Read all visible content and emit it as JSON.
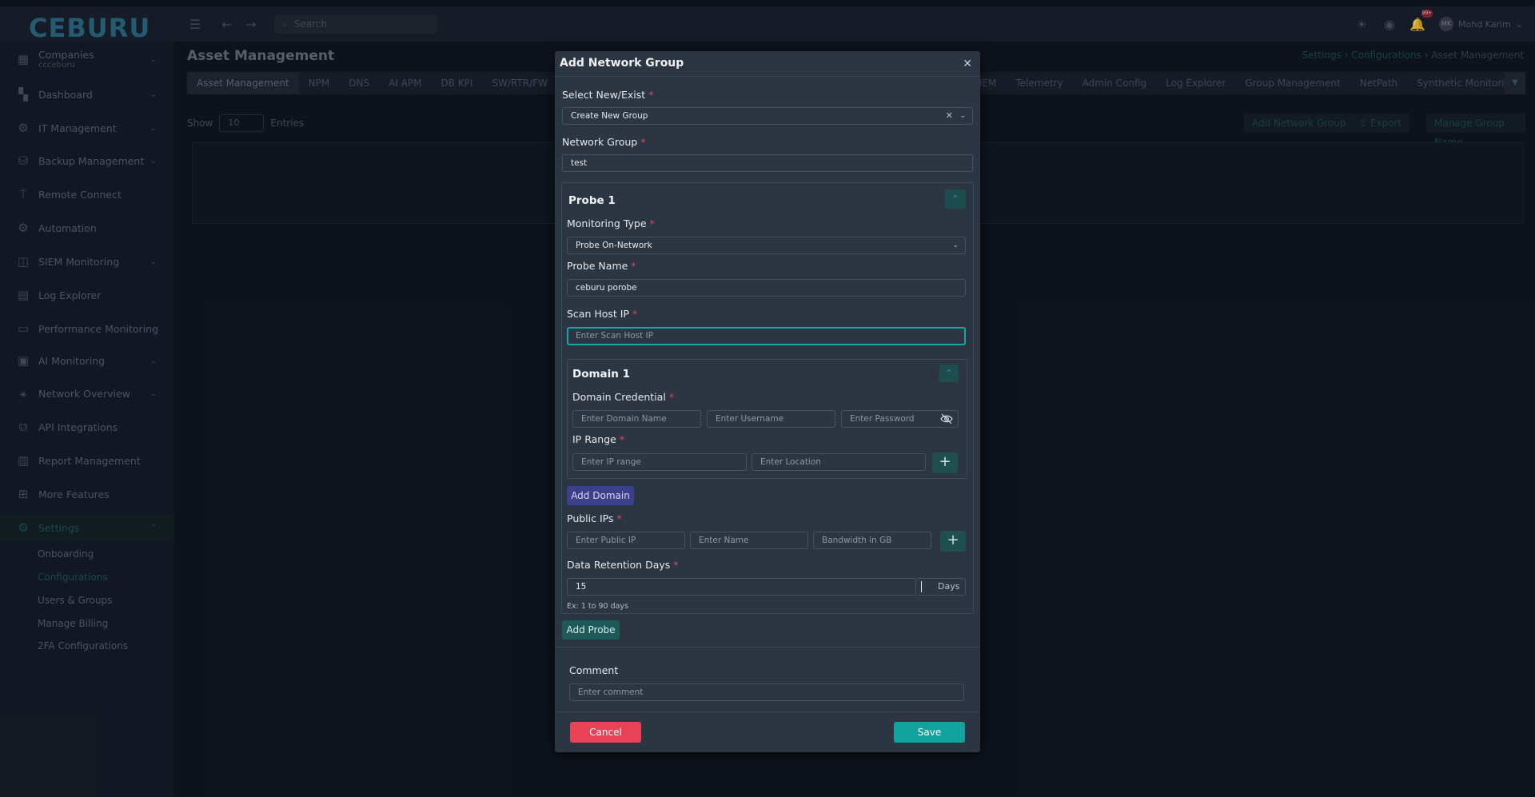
{
  "app": {
    "logo": "CEBURU",
    "search_placeholder": "Search",
    "user_name": "Mohd Karim",
    "user_initials": "MK",
    "notification_count": "99+"
  },
  "sidebar": {
    "company_label": "Companies",
    "company_name": "ccceburu",
    "items": [
      {
        "label": "Dashboard",
        "icon": "dashboard-icon"
      },
      {
        "label": "IT Management",
        "icon": "it-management-icon"
      },
      {
        "label": "Backup Management",
        "icon": "database-icon"
      },
      {
        "label": "Remote Connect",
        "icon": "remote-icon"
      },
      {
        "label": "Automation",
        "icon": "gear-icon"
      },
      {
        "label": "SIEM Monitoring",
        "icon": "siem-icon"
      },
      {
        "label": "Log Explorer",
        "icon": "file-icon"
      },
      {
        "label": "Performance Monitoring",
        "icon": "monitor-icon"
      },
      {
        "label": "AI Monitoring",
        "icon": "ai-icon"
      },
      {
        "label": "Network Overview",
        "icon": "network-icon"
      },
      {
        "label": "API Integrations",
        "icon": "api-icon"
      },
      {
        "label": "Report Management",
        "icon": "report-icon"
      },
      {
        "label": "More Features",
        "icon": "grid-icon"
      },
      {
        "label": "Settings",
        "icon": "settings-icon"
      }
    ],
    "settings_sub": [
      "Onboarding",
      "Configurations",
      "Users & Groups",
      "Manage Billing",
      "2FA Configurations"
    ]
  },
  "page": {
    "title": "Asset Management",
    "breadcrumb": [
      "Settings",
      "Configurations",
      "Asset Management"
    ],
    "tabs": [
      "Asset Management",
      "NPM",
      "DNS",
      "AI APM",
      "DB KPI",
      "SW/RTR/FW",
      "IEM",
      "Telemetry",
      "Admin Config",
      "Log Explorer",
      "Group Management",
      "NetPath",
      "Synthetic Monitoring"
    ],
    "show_label": "Show",
    "entries_value": "10",
    "entries_label": "Entries",
    "add_network_group": "Add Network Group",
    "export": "Export",
    "manage_group_name": "Manage Group Name"
  },
  "modal": {
    "title": "Add Network Group",
    "select_label": "Select New/Exist",
    "select_value": "Create New Group",
    "network_group_label": "Network Group",
    "network_group_value": "test",
    "probe": {
      "title": "Probe 1",
      "monitoring_type_label": "Monitoring Type",
      "monitoring_type_value": "Probe On-Network",
      "probe_name_label": "Probe Name",
      "probe_name_value": "ceburu porobe",
      "scan_host_label": "Scan Host IP",
      "scan_host_placeholder": "Enter Scan Host IP",
      "domain": {
        "title": "Domain 1",
        "credential_label": "Domain Credential",
        "domain_name_placeholder": "Enter Domain Name",
        "username_placeholder": "Enter Username",
        "password_placeholder": "Enter Password",
        "ip_range_label": "IP Range",
        "ip_range_placeholder": "Enter IP range",
        "location_placeholder": "Enter Location"
      },
      "add_domain": "Add Domain",
      "public_ips_label": "Public IPs",
      "public_ip_placeholder": "Enter Public IP",
      "name_placeholder": "Enter Name",
      "bandwidth_placeholder": "Bandwidth in GB",
      "retention_label": "Data Retention Days",
      "retention_value": "15",
      "retention_unit": "Days",
      "retention_hint": "Ex: 1 to 90 days"
    },
    "add_probe": "Add Probe",
    "comment_label": "Comment",
    "comment_placeholder": "Enter comment",
    "cancel": "Cancel",
    "save": "Save"
  },
  "colors": {
    "accent": "#14a39c",
    "danger": "#e84257",
    "domain_button": "#3c3f8a",
    "modal_bg": "#2c3542"
  }
}
